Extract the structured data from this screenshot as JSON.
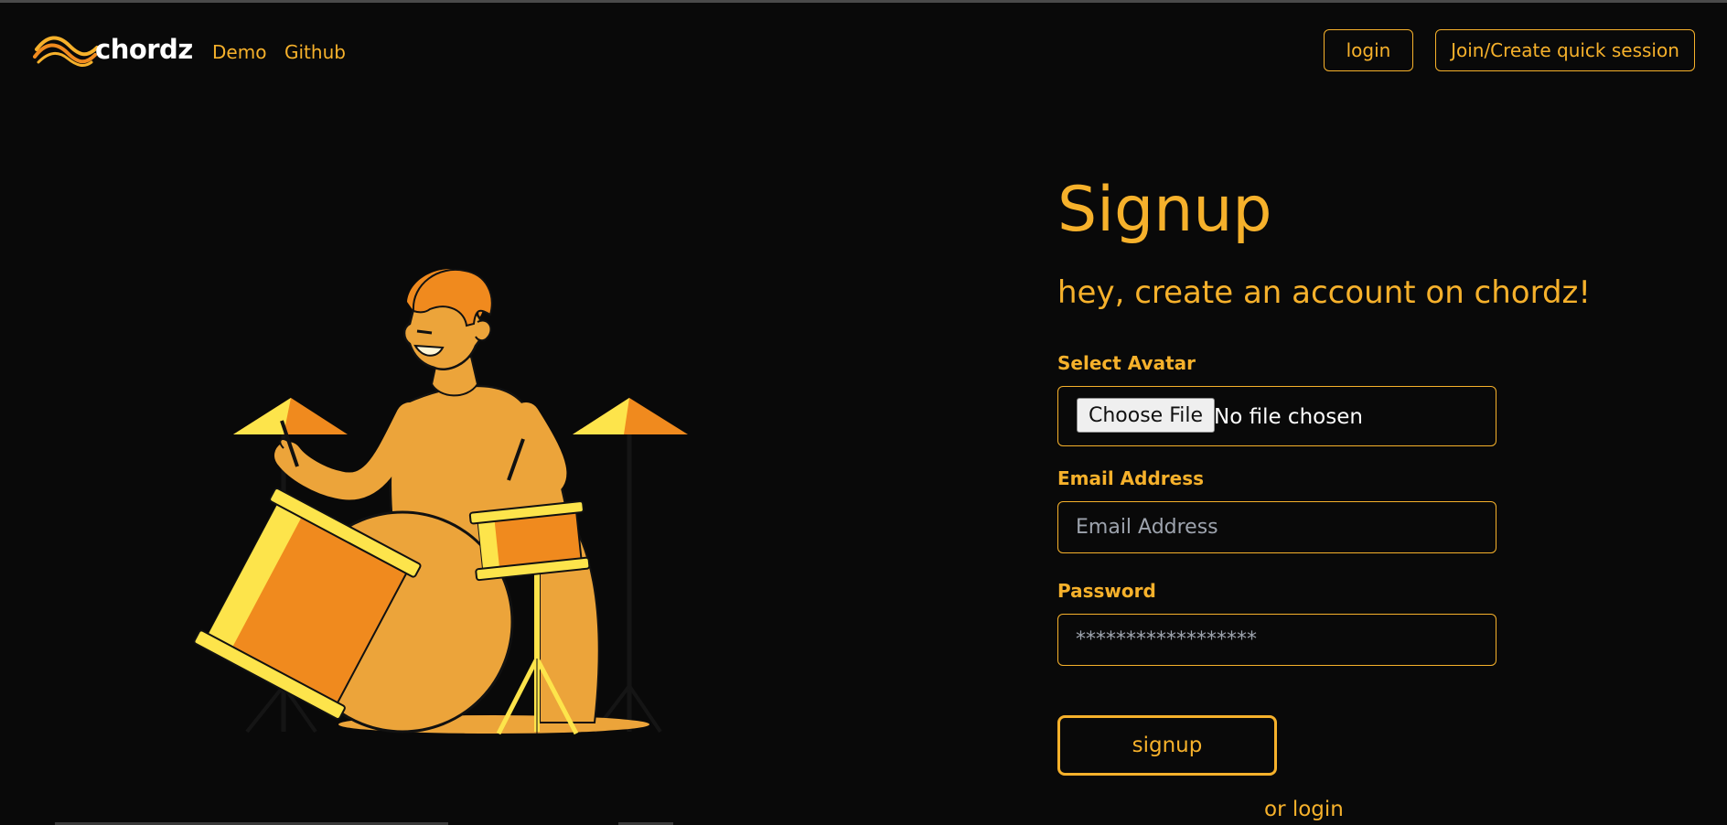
{
  "brand": {
    "name": "chordz",
    "logo_icon": "wave-logo-icon"
  },
  "nav": {
    "links": [
      "Demo",
      "Github"
    ],
    "login_label": "login",
    "session_label": "Join/Create quick session"
  },
  "form": {
    "title": "Signup",
    "subtitle": "hey, create an account on chordz!",
    "avatar_label": "Select Avatar",
    "choose_file_label": "Choose File",
    "file_status": "No file chosen",
    "email_label": "Email Address",
    "email_placeholder": "Email Address",
    "password_label": "Password",
    "password_placeholder": "******************",
    "submit_label": "signup",
    "alt_link": "or login"
  },
  "illustration": {
    "icon": "drummer-illustration"
  },
  "colors": {
    "accent": "#f6b12b",
    "background": "#090909",
    "orange": "#f08a1e",
    "yellow": "#fde44b",
    "skin": "#eca43a"
  }
}
